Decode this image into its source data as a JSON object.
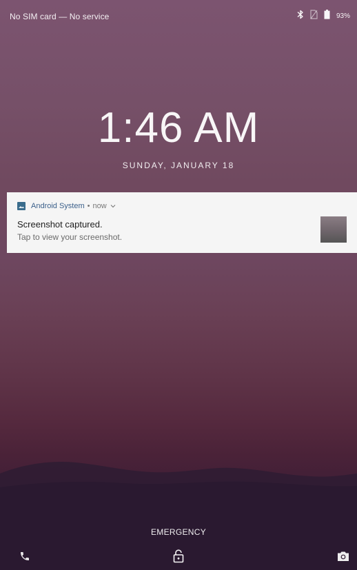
{
  "status_bar": {
    "carrier": "No SIM card — No service",
    "battery_percent": "93%",
    "icons": [
      "bluetooth-icon",
      "no-sim-icon",
      "battery-icon"
    ]
  },
  "lockscreen": {
    "time": "1:46 AM",
    "date": "SUNDAY, JANUARY 18"
  },
  "notification": {
    "app_name": "Android System",
    "separator": "•",
    "time": "now",
    "title": "Screenshot captured.",
    "body": "Tap to view your screenshot.",
    "icon": "screenshot-app-icon",
    "accent_color": "#3a6c8c"
  },
  "bottom": {
    "emergency_label": "EMERGENCY",
    "icons": [
      "phone-icon",
      "unlock-icon",
      "camera-icon"
    ]
  }
}
